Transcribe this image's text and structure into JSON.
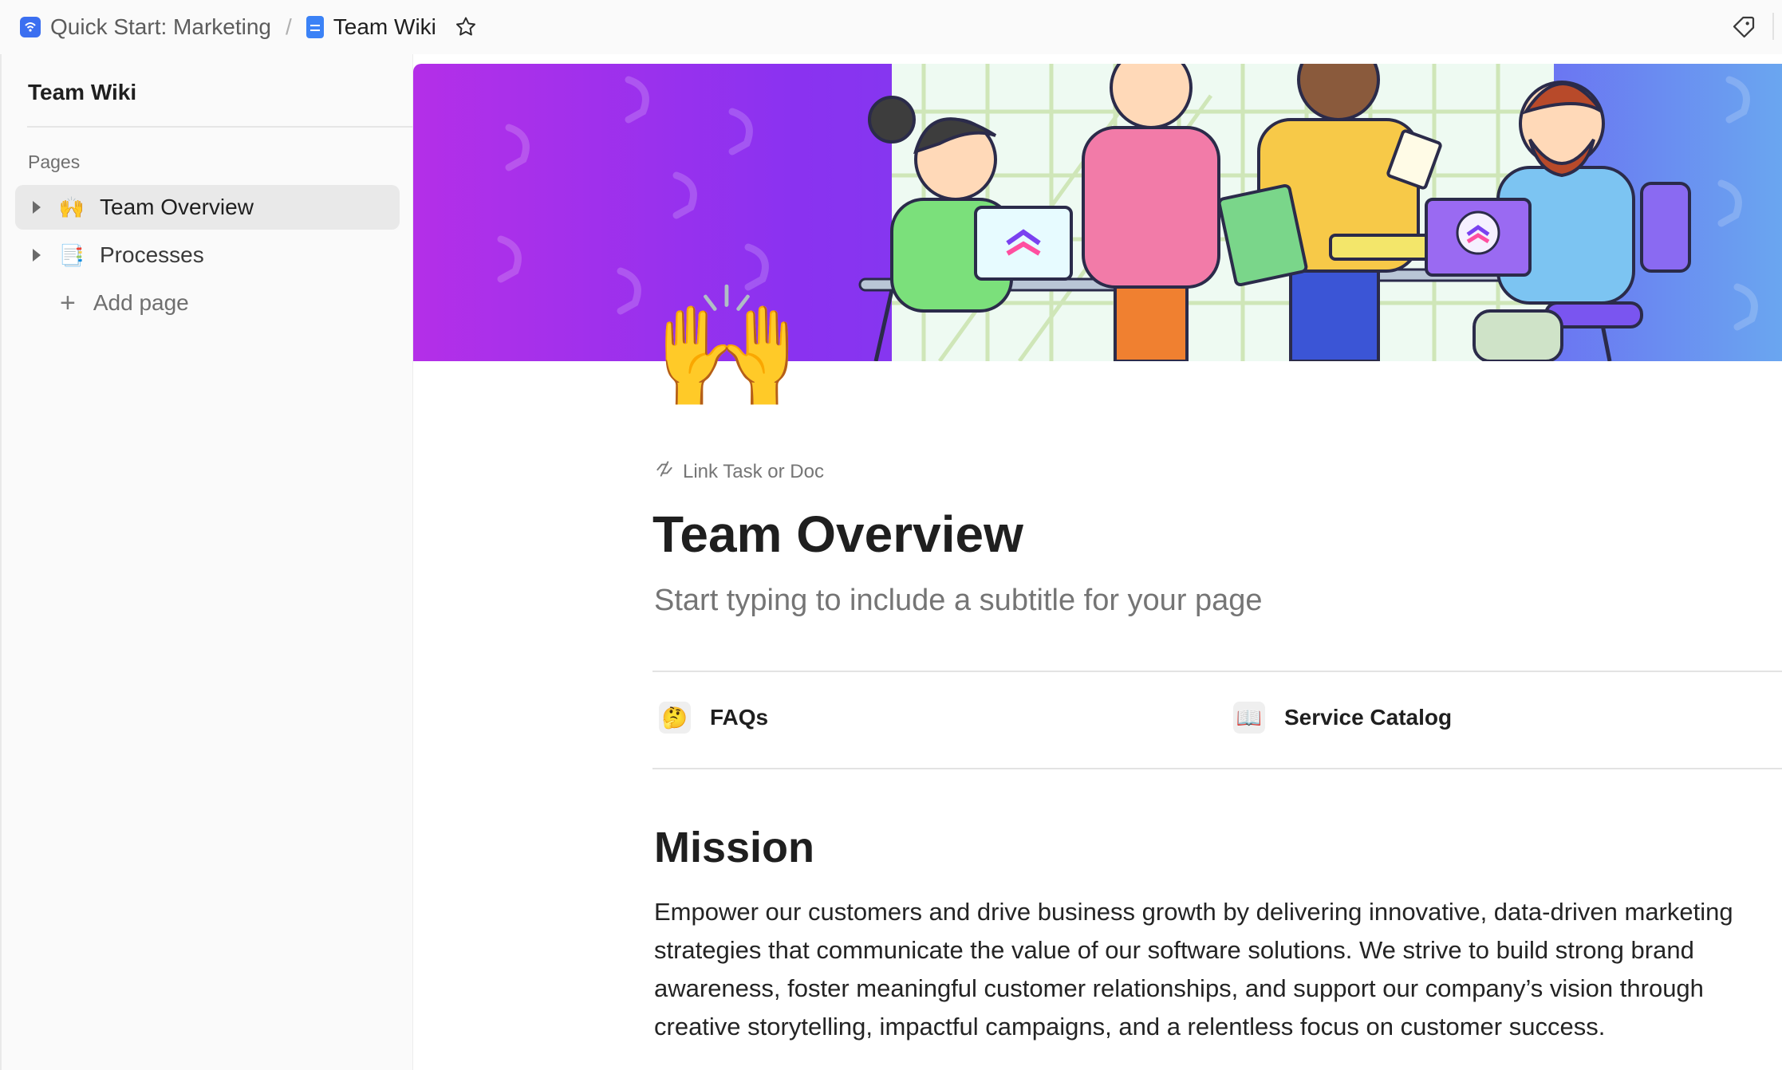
{
  "breadcrumb": {
    "space": "Quick Start: Marketing",
    "separator": "/",
    "doc": "Team Wiki"
  },
  "sidebar": {
    "title": "Team Wiki",
    "section_label": "Pages",
    "items": [
      {
        "emoji": "🙌",
        "label": "Team Overview",
        "active": true
      },
      {
        "emoji": "📑",
        "label": "Processes",
        "active": false
      }
    ],
    "add_label": "Add page"
  },
  "page": {
    "icon_emoji": "🙌",
    "link_label": "Link Task or Doc",
    "title": "Team Overview",
    "subtitle_placeholder": "Start typing to include a subtitle for your page",
    "links": [
      {
        "emoji": "🤔",
        "label": "FAQs"
      },
      {
        "emoji": "📖",
        "label": "Service Catalog"
      }
    ],
    "section_heading": "Mission",
    "body_lines": [
      "Empower our customers and drive business growth by delivering innovative, data-driven marketing",
      "strategies that communicate the value of our software solutions. We strive to build strong brand",
      "awareness, foster meaningful customer relationships, and support our company’s vision through",
      "creative storytelling, impactful campaigns, and a relentless focus on customer success."
    ]
  },
  "icons": {
    "space": "space-wifi-icon",
    "doc": "doc-icon",
    "favorite": "star-icon",
    "tags": "tag-icon",
    "link": "link-icon",
    "expand": "caret-right-icon",
    "add": "plus-icon"
  },
  "colors": {
    "accent_blue": "#3b82f6",
    "banner_start": "#b42fe8",
    "banner_end": "#6aa6f0",
    "active_item_bg": "#e9e9e9"
  }
}
